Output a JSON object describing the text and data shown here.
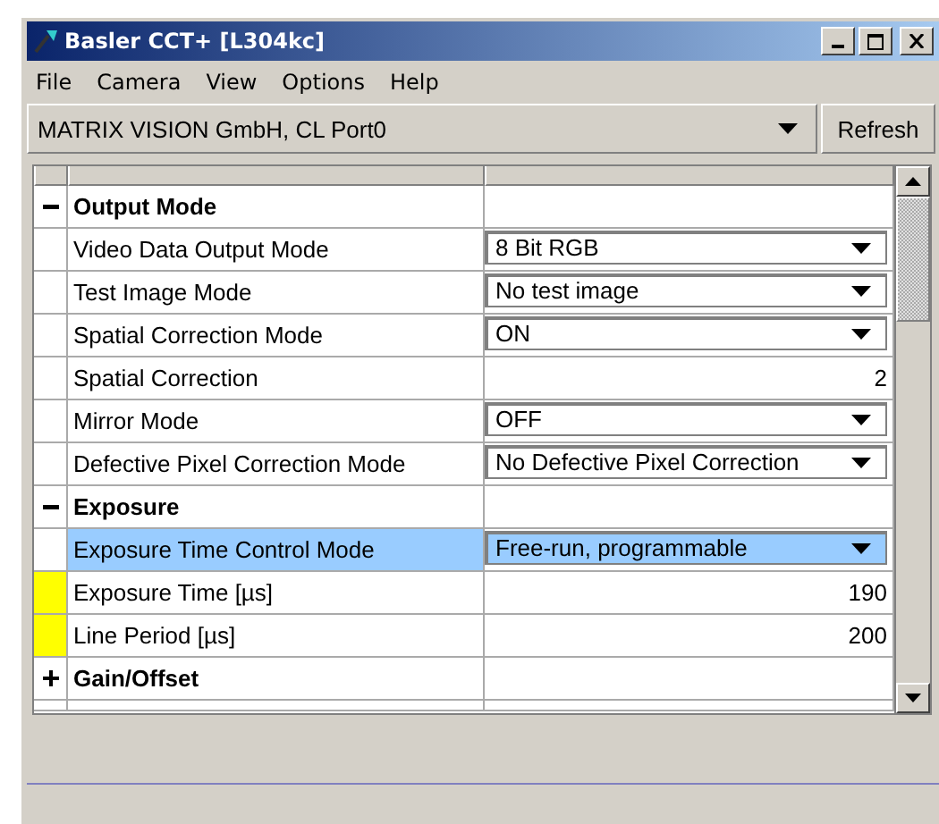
{
  "window": {
    "title": "Basler CCT+ [L304kc]"
  },
  "menu": [
    "File",
    "Camera",
    "View",
    "Options",
    "Help"
  ],
  "port": {
    "value": "MATRIX VISION GmbH, CL Port0",
    "button": "Refresh"
  },
  "rows": [
    {
      "kind": "group",
      "name": "Output Mode",
      "expanded": true
    },
    {
      "kind": "dropdown",
      "name": "Video Data Output Mode",
      "value": "8 Bit RGB",
      "selected": false,
      "flagged": false
    },
    {
      "kind": "dropdown",
      "name": "Test Image Mode",
      "value": "No test image",
      "selected": false,
      "flagged": false
    },
    {
      "kind": "dropdown",
      "name": "Spatial Correction Mode",
      "value": "ON",
      "selected": false,
      "flagged": false
    },
    {
      "kind": "number",
      "name": "Spatial Correction",
      "value": "2",
      "selected": false,
      "flagged": false
    },
    {
      "kind": "dropdown",
      "name": "Mirror Mode",
      "value": "OFF",
      "selected": false,
      "flagged": false
    },
    {
      "kind": "dropdown",
      "name": "Defective Pixel Correction Mode",
      "value": "No Defective Pixel Correction",
      "selected": false,
      "flagged": false
    },
    {
      "kind": "group",
      "name": "Exposure",
      "expanded": true
    },
    {
      "kind": "dropdown",
      "name": "Exposure Time Control Mode",
      "value": "Free-run, programmable",
      "selected": true,
      "flagged": false
    },
    {
      "kind": "number",
      "name": "Exposure Time [µs]",
      "value": "190",
      "selected": false,
      "flagged": true
    },
    {
      "kind": "number",
      "name": "Line Period [µs]",
      "value": "200",
      "selected": false,
      "flagged": true
    },
    {
      "kind": "group",
      "name": "Gain/Offset",
      "expanded": false
    }
  ]
}
